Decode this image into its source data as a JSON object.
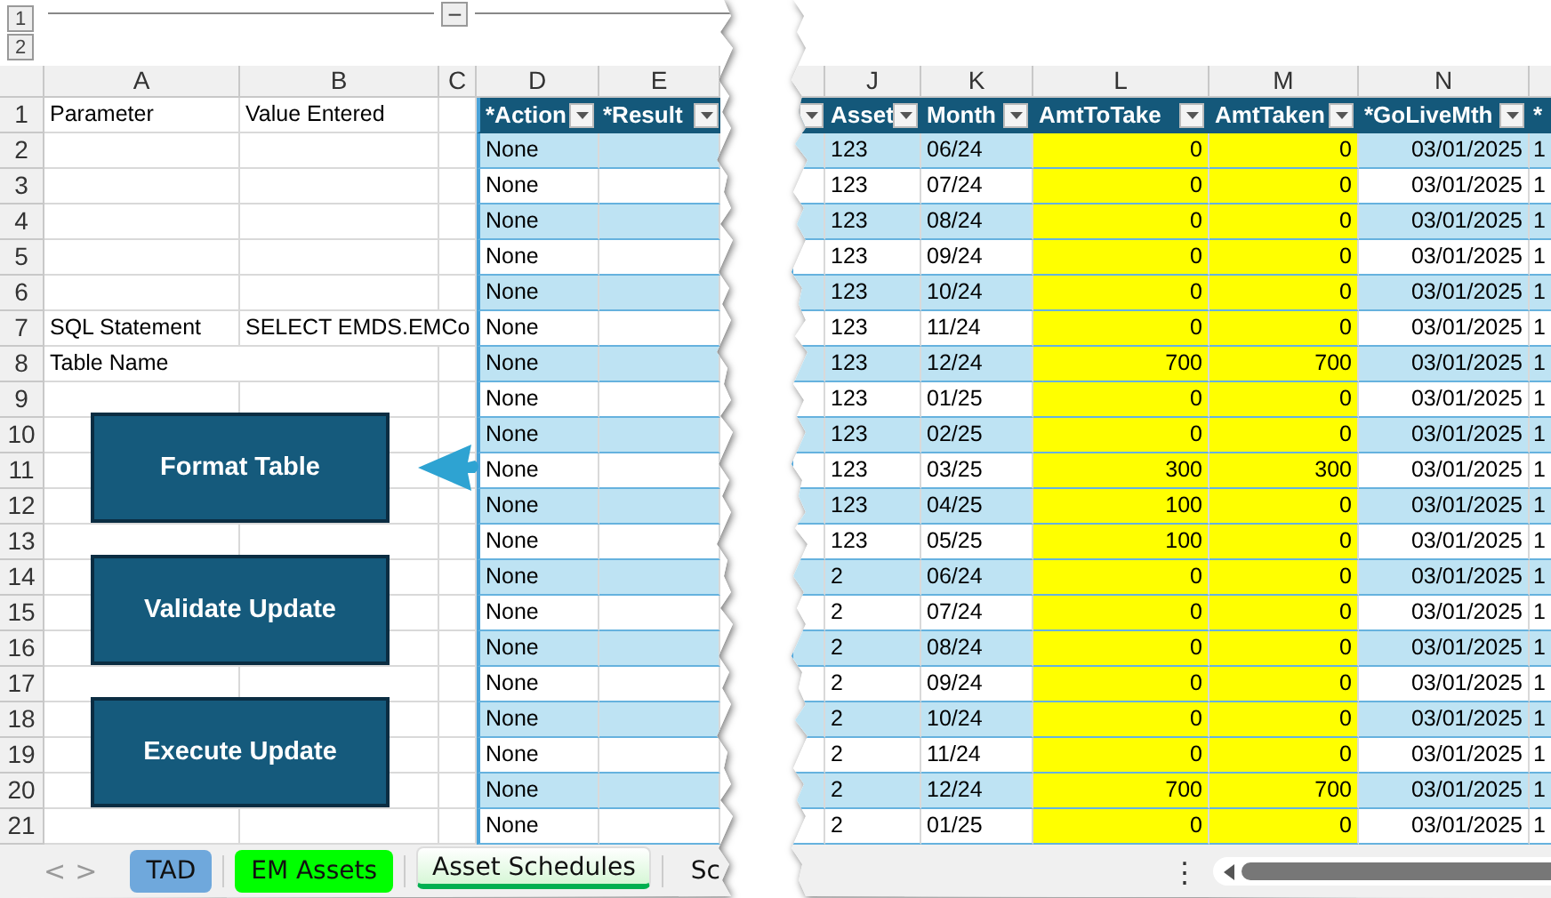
{
  "outline": {
    "levels": [
      "1",
      "2"
    ],
    "collapse": "−"
  },
  "left_sheet": {
    "columns": [
      {
        "letter": "A",
        "kind": "plain"
      },
      {
        "letter": "B",
        "kind": "plain"
      },
      {
        "letter": "C",
        "kind": "plain"
      },
      {
        "letter": "D",
        "kind": "table"
      },
      {
        "letter": "E",
        "kind": "table"
      }
    ],
    "rows": [
      {
        "number": "1",
        "header": true,
        "cells": [
          "Parameter",
          "Value Entered",
          null,
          "*Action",
          "*Result"
        ]
      },
      {
        "number": "2",
        "shaded": true,
        "cells": [
          null,
          null,
          null,
          "None",
          null
        ]
      },
      {
        "number": "3",
        "shaded": false,
        "cells": [
          null,
          null,
          null,
          "None",
          null
        ]
      },
      {
        "number": "4",
        "shaded": true,
        "cells": [
          null,
          null,
          null,
          "None",
          null
        ]
      },
      {
        "number": "5",
        "shaded": false,
        "cells": [
          null,
          null,
          null,
          "None",
          null
        ]
      },
      {
        "number": "6",
        "shaded": true,
        "cells": [
          null,
          null,
          null,
          "None",
          null
        ]
      },
      {
        "number": "7",
        "shaded": false,
        "cells": [
          "SQL Statement",
          "SELECT EMDS.EMCo",
          null,
          "None",
          null
        ]
      },
      {
        "number": "8",
        "shaded": true,
        "cells": [
          "Table Name",
          null,
          null,
          "None",
          null
        ]
      },
      {
        "number": "9",
        "shaded": false,
        "cells": [
          null,
          null,
          null,
          "None",
          null
        ]
      },
      {
        "number": "10",
        "shaded": true,
        "cells": [
          null,
          null,
          null,
          "None",
          null
        ]
      },
      {
        "number": "11",
        "shaded": false,
        "cells": [
          null,
          null,
          null,
          "None",
          null
        ]
      },
      {
        "number": "12",
        "shaded": true,
        "cells": [
          null,
          null,
          null,
          "None",
          null
        ]
      },
      {
        "number": "13",
        "shaded": false,
        "cells": [
          null,
          null,
          null,
          "None",
          null
        ]
      },
      {
        "number": "14",
        "shaded": true,
        "cells": [
          null,
          null,
          null,
          "None",
          null
        ]
      },
      {
        "number": "15",
        "shaded": false,
        "cells": [
          null,
          null,
          null,
          "None",
          null
        ]
      },
      {
        "number": "16",
        "shaded": true,
        "cells": [
          null,
          null,
          null,
          "None",
          null
        ]
      },
      {
        "number": "17",
        "shaded": false,
        "cells": [
          null,
          null,
          null,
          "None",
          null
        ]
      },
      {
        "number": "18",
        "shaded": true,
        "cells": [
          null,
          null,
          null,
          "None",
          null
        ]
      },
      {
        "number": "19",
        "shaded": false,
        "cells": [
          null,
          null,
          null,
          "None",
          null
        ]
      },
      {
        "number": "20",
        "shaded": true,
        "cells": [
          null,
          null,
          null,
          "None",
          null
        ]
      },
      {
        "number": "21",
        "shaded": false,
        "cells": [
          null,
          null,
          null,
          "None",
          null
        ]
      }
    ]
  },
  "macro_buttons": [
    {
      "label": "Format Table"
    },
    {
      "label": "Validate Update"
    },
    {
      "label": "Execute Update"
    }
  ],
  "right_sheet": {
    "columns": [
      {
        "kind": "table"
      },
      {
        "letter": "J",
        "kind": "table"
      },
      {
        "letter": "K",
        "kind": "table"
      },
      {
        "letter": "L",
        "kind": "table",
        "numeric": true,
        "color": "#ffff00"
      },
      {
        "letter": "M",
        "kind": "table",
        "numeric": true,
        "color": "#ffff00"
      },
      {
        "letter": "N",
        "kind": "table",
        "numeric": true
      },
      {
        "kind": "table"
      }
    ],
    "rows": [
      {
        "header": true,
        "cells": [
          null,
          "Asset",
          "Month",
          "AmtToTake",
          "AmtTaken",
          "*GoLiveMth",
          "*"
        ]
      },
      {
        "shaded": true,
        "cells": [
          null,
          "123",
          "06/24",
          "0",
          "0",
          "03/01/2025",
          "1"
        ]
      },
      {
        "shaded": false,
        "cells": [
          null,
          "123",
          "07/24",
          "0",
          "0",
          "03/01/2025",
          "1"
        ]
      },
      {
        "shaded": true,
        "cells": [
          null,
          "123",
          "08/24",
          "0",
          "0",
          "03/01/2025",
          "1"
        ]
      },
      {
        "shaded": false,
        "cells": [
          null,
          "123",
          "09/24",
          "0",
          "0",
          "03/01/2025",
          "1"
        ]
      },
      {
        "shaded": true,
        "cells": [
          null,
          "123",
          "10/24",
          "0",
          "0",
          "03/01/2025",
          "1"
        ]
      },
      {
        "shaded": false,
        "cells": [
          null,
          "123",
          "11/24",
          "0",
          "0",
          "03/01/2025",
          "1"
        ]
      },
      {
        "shaded": true,
        "cells": [
          null,
          "123",
          "12/24",
          "700",
          "700",
          "03/01/2025",
          "1"
        ]
      },
      {
        "shaded": false,
        "cells": [
          null,
          "123",
          "01/25",
          "0",
          "0",
          "03/01/2025",
          "1"
        ]
      },
      {
        "shaded": true,
        "cells": [
          null,
          "123",
          "02/25",
          "0",
          "0",
          "03/01/2025",
          "1"
        ]
      },
      {
        "shaded": false,
        "cells": [
          null,
          "123",
          "03/25",
          "300",
          "300",
          "03/01/2025",
          "1"
        ]
      },
      {
        "shaded": true,
        "cells": [
          null,
          "123",
          "04/25",
          "100",
          "0",
          "03/01/2025",
          "1"
        ]
      },
      {
        "shaded": false,
        "cells": [
          null,
          "123",
          "05/25",
          "100",
          "0",
          "03/01/2025",
          "1"
        ]
      },
      {
        "shaded": true,
        "cells": [
          null,
          "2",
          "06/24",
          "0",
          "0",
          "03/01/2025",
          "1"
        ]
      },
      {
        "shaded": false,
        "cells": [
          null,
          "2",
          "07/24",
          "0",
          "0",
          "03/01/2025",
          "1"
        ]
      },
      {
        "shaded": true,
        "cells": [
          null,
          "2",
          "08/24",
          "0",
          "0",
          "03/01/2025",
          "1"
        ]
      },
      {
        "shaded": false,
        "cells": [
          null,
          "2",
          "09/24",
          "0",
          "0",
          "03/01/2025",
          "1"
        ]
      },
      {
        "shaded": true,
        "cells": [
          null,
          "2",
          "10/24",
          "0",
          "0",
          "03/01/2025",
          "1"
        ]
      },
      {
        "shaded": false,
        "cells": [
          null,
          "2",
          "11/24",
          "0",
          "0",
          "03/01/2025",
          "1"
        ]
      },
      {
        "shaded": true,
        "cells": [
          null,
          "2",
          "12/24",
          "700",
          "700",
          "03/01/2025",
          "1"
        ]
      },
      {
        "shaded": false,
        "cells": [
          null,
          "2",
          "01/25",
          "0",
          "0",
          "03/01/2025",
          "1"
        ]
      }
    ]
  },
  "sheet_tabs": {
    "nav": [
      "<",
      ">"
    ],
    "tabs": [
      {
        "label": "TAD",
        "color": "#6fa8dc",
        "selected": false
      },
      {
        "label": "EM Assets",
        "color": "#00ff00",
        "selected": false
      },
      {
        "label": "Asset Schedules",
        "color": "#00b050",
        "selected": true
      },
      {
        "label": "Sc",
        "selected": false
      }
    ]
  },
  "scroll_menu": "⋮"
}
